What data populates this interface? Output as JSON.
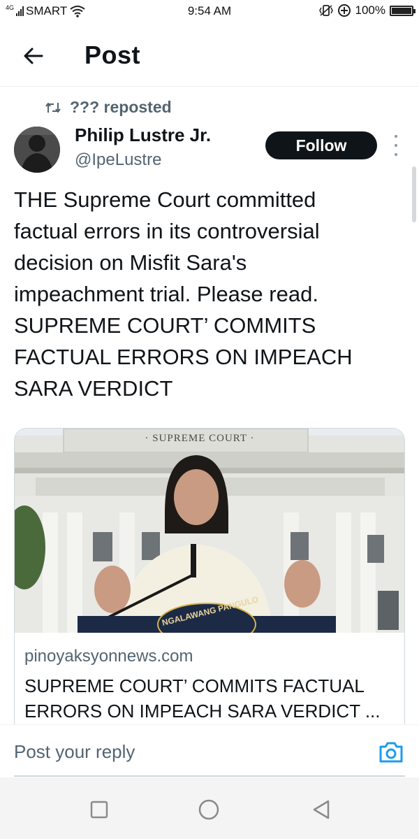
{
  "status_bar": {
    "network": "4G",
    "carrier": "SMART",
    "time": "9:54 AM",
    "battery_text": "100%",
    "battery_level": 1.0
  },
  "header": {
    "title": "Post",
    "back_icon": "arrow-left-icon"
  },
  "repost": {
    "label": "??? reposted",
    "icon": "repost-icon"
  },
  "author": {
    "name": "Philip Lustre Jr.",
    "handle": "@IpeLustre",
    "follow_label": "Follow",
    "more_icon": "more-vertical-icon"
  },
  "post": {
    "text": "THE Supreme Court committed\nfactual errors in its controversial\ndecision on Misfit Sara's\nimpeachment trial. Please read.\nSUPREME COURT’ COMMITS\nFACTUAL ERRORS ON IMPEACH\nSARA VERDICT"
  },
  "link_card": {
    "image_sign": "· SUPREME COURT ·",
    "image_seal": "NGALAWANG PANGULO",
    "domain": "pinoyaksyonnews.com",
    "title": "SUPREME COURT’ COMMITS FACTUAL\nERRORS ON IMPEACH SARA VERDICT ..."
  },
  "reply": {
    "placeholder": "Post your reply",
    "camera_icon": "camera-icon",
    "accent": "#1d9bf0"
  },
  "nav_bar": {
    "recents_icon": "square-icon",
    "home_icon": "circle-icon",
    "back_icon": "triangle-back-icon"
  }
}
